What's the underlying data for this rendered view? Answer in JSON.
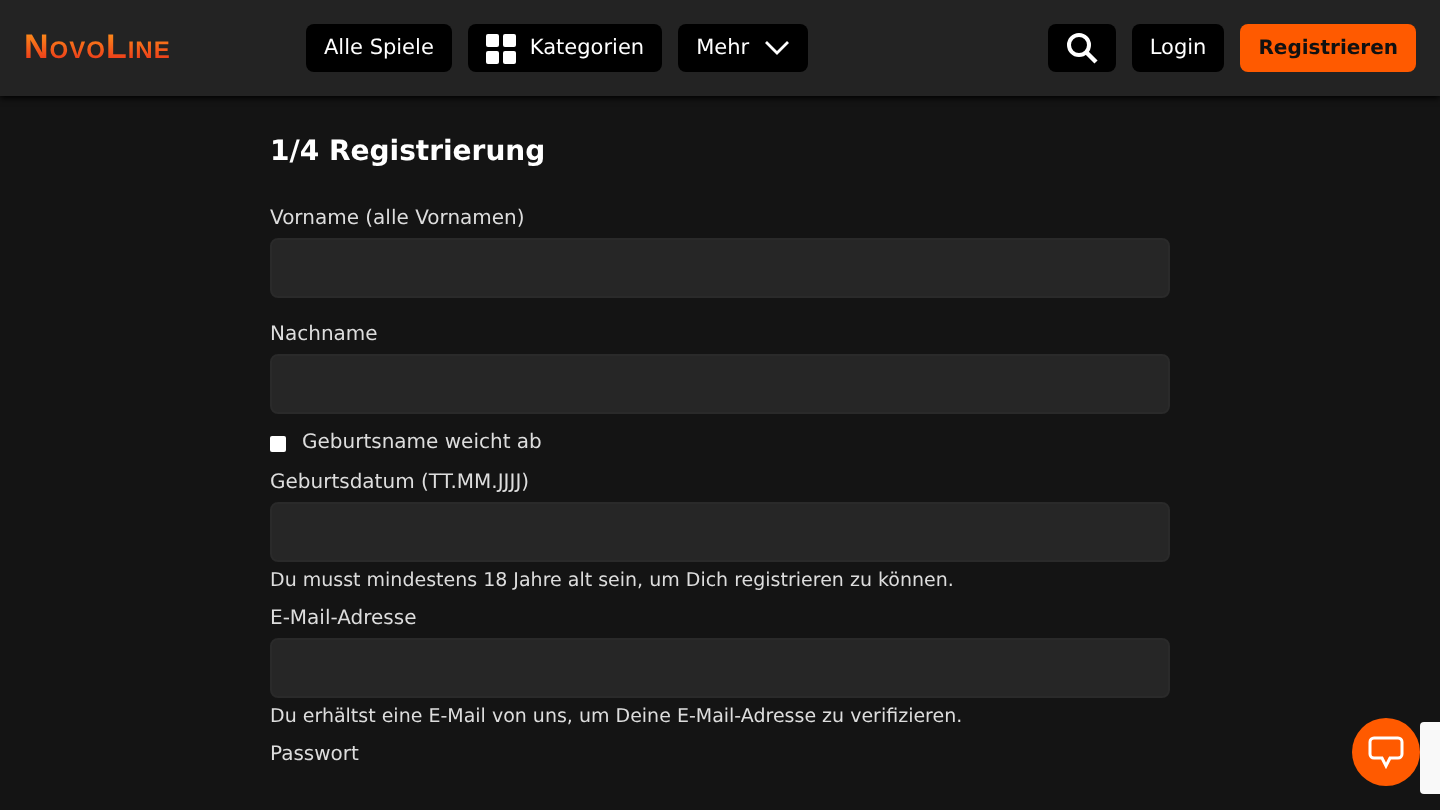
{
  "header": {
    "logo": "NovoLine",
    "nav": [
      {
        "label": "Alle Spiele",
        "kind": "plain"
      },
      {
        "label": "Kategorien",
        "kind": "grid"
      },
      {
        "label": "Mehr",
        "kind": "menu"
      }
    ],
    "login": "Login",
    "register": "Registrieren"
  },
  "form": {
    "title": "1/4 Registrierung",
    "fields": [
      {
        "kind": "text",
        "label": "Vorname (alle Vornamen)"
      },
      {
        "kind": "text",
        "label": "Nachname"
      },
      {
        "kind": "checkbox",
        "label": "Geburtsname weicht ab",
        "checked": false
      },
      {
        "kind": "text",
        "label": "Geburtsdatum (TT.MM.JJJJ)",
        "hint": "Du musst mindestens 18 Jahre alt sein, um Dich registrieren zu können."
      },
      {
        "kind": "text",
        "label": "E-Mail-Adresse",
        "hint": "Du erhältst eine E-Mail von uns, um Deine E-Mail-Adresse zu verifizieren."
      },
      {
        "kind": "label",
        "label": "Passwort"
      }
    ]
  }
}
